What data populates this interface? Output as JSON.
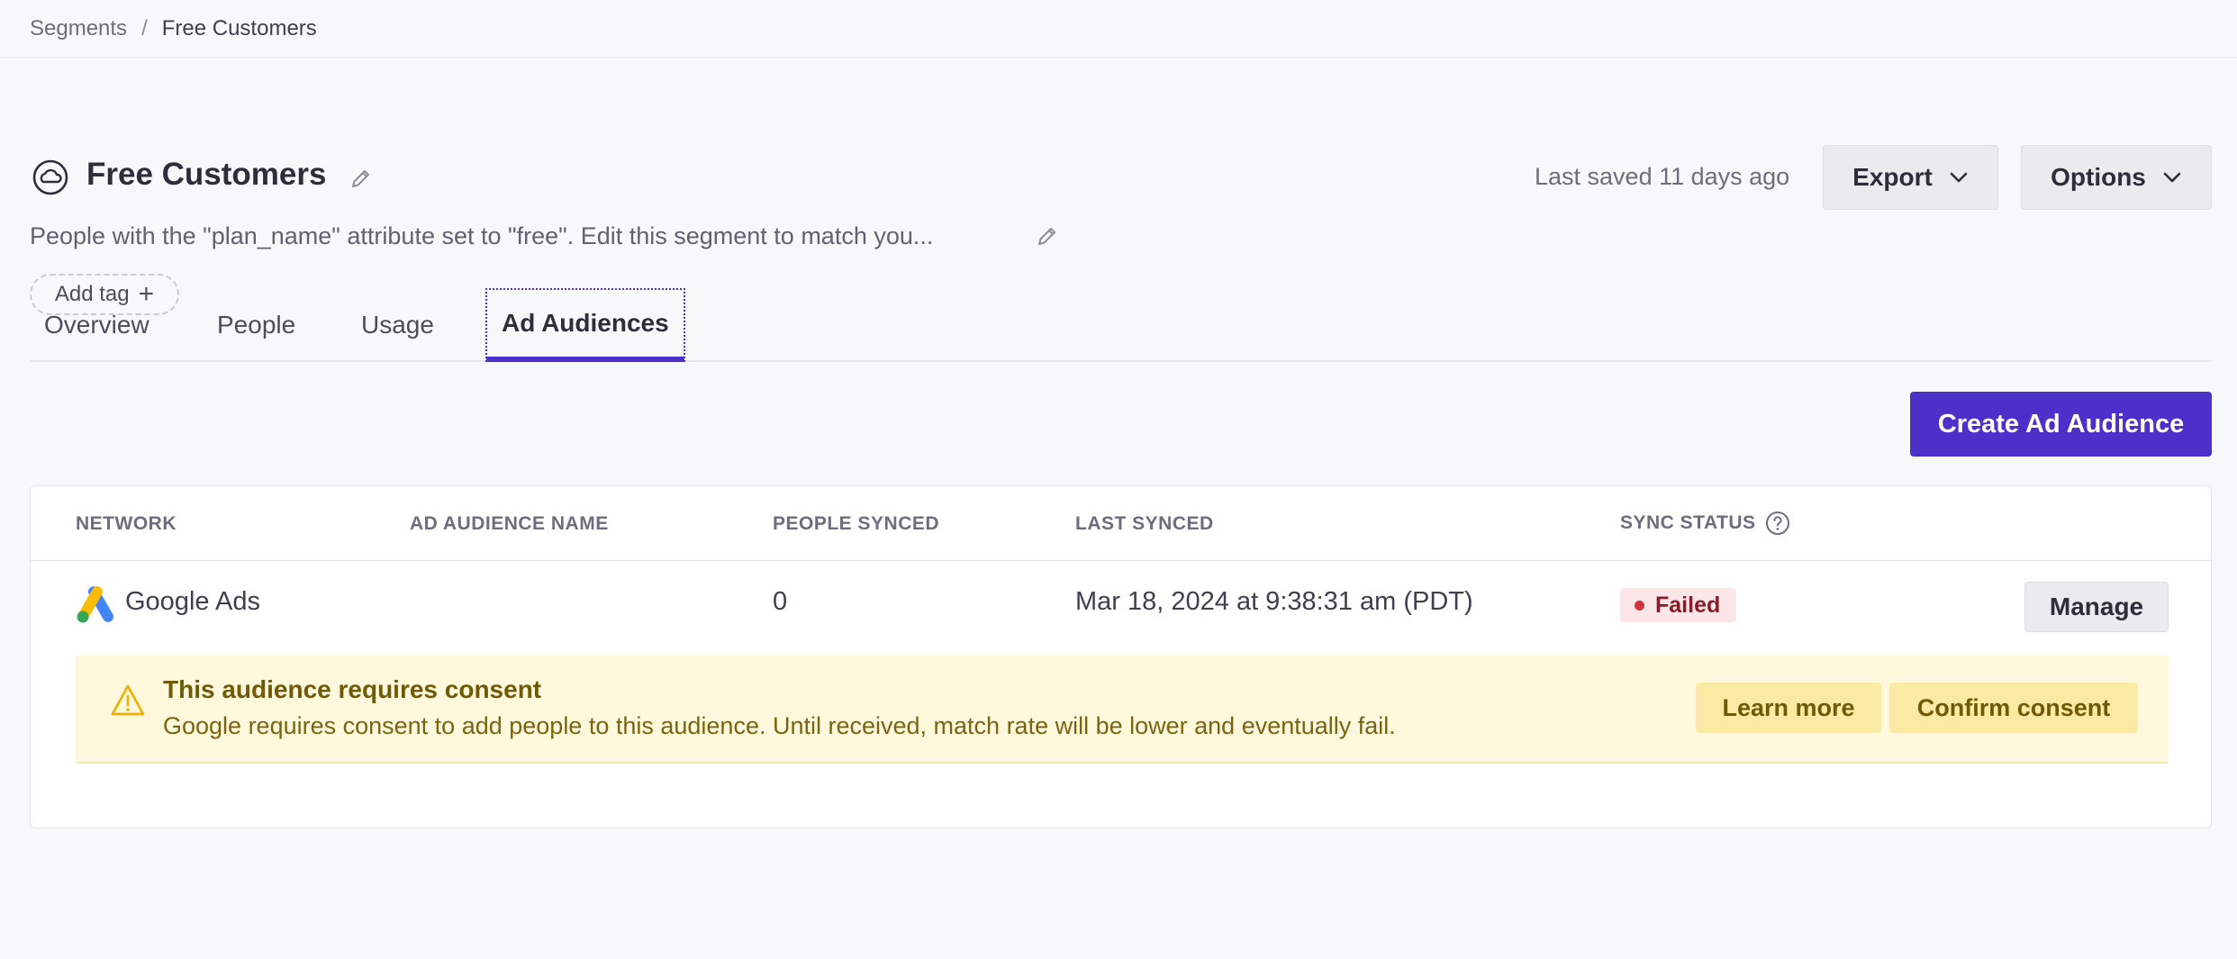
{
  "breadcrumb": {
    "parent": "Segments",
    "separator": "/",
    "current": "Free Customers"
  },
  "segment": {
    "title": "Free Customers",
    "description": "People with the \"plan_name\" attribute set to \"free\". Edit this segment to match you...",
    "add_tag_label": "Add tag",
    "last_saved": "Last saved 11 days ago"
  },
  "header_buttons": {
    "export_label": "Export",
    "options_label": "Options"
  },
  "tabs": [
    {
      "label": "Overview"
    },
    {
      "label": "People"
    },
    {
      "label": "Usage"
    },
    {
      "label": "Ad Audiences",
      "active": true
    }
  ],
  "create_button_label": "Create Ad Audience",
  "table": {
    "columns": [
      "NETWORK",
      "AD AUDIENCE NAME",
      "PEOPLE SYNCED",
      "LAST SYNCED",
      "SYNC STATUS"
    ],
    "rows": [
      {
        "network": "Google Ads",
        "audience_name": "",
        "people_synced": "0",
        "last_synced": "Mar 18, 2024 at 9:38:31 am (PDT)",
        "sync_status": "Failed",
        "action_label": "Manage"
      }
    ]
  },
  "consent_notice": {
    "title": "This audience requires consent",
    "body": "Google requires consent to add people to this audience. Until received, match rate will be lower and eventually fail.",
    "learn_more_label": "Learn more",
    "confirm_label": "Confirm consent"
  },
  "colors": {
    "accent": "#4b31c9",
    "failed_bg": "#fde6e8",
    "failed_text": "#8a1c2a",
    "warning_bg": "#fef8dc",
    "warning_text": "#6f5a07"
  }
}
